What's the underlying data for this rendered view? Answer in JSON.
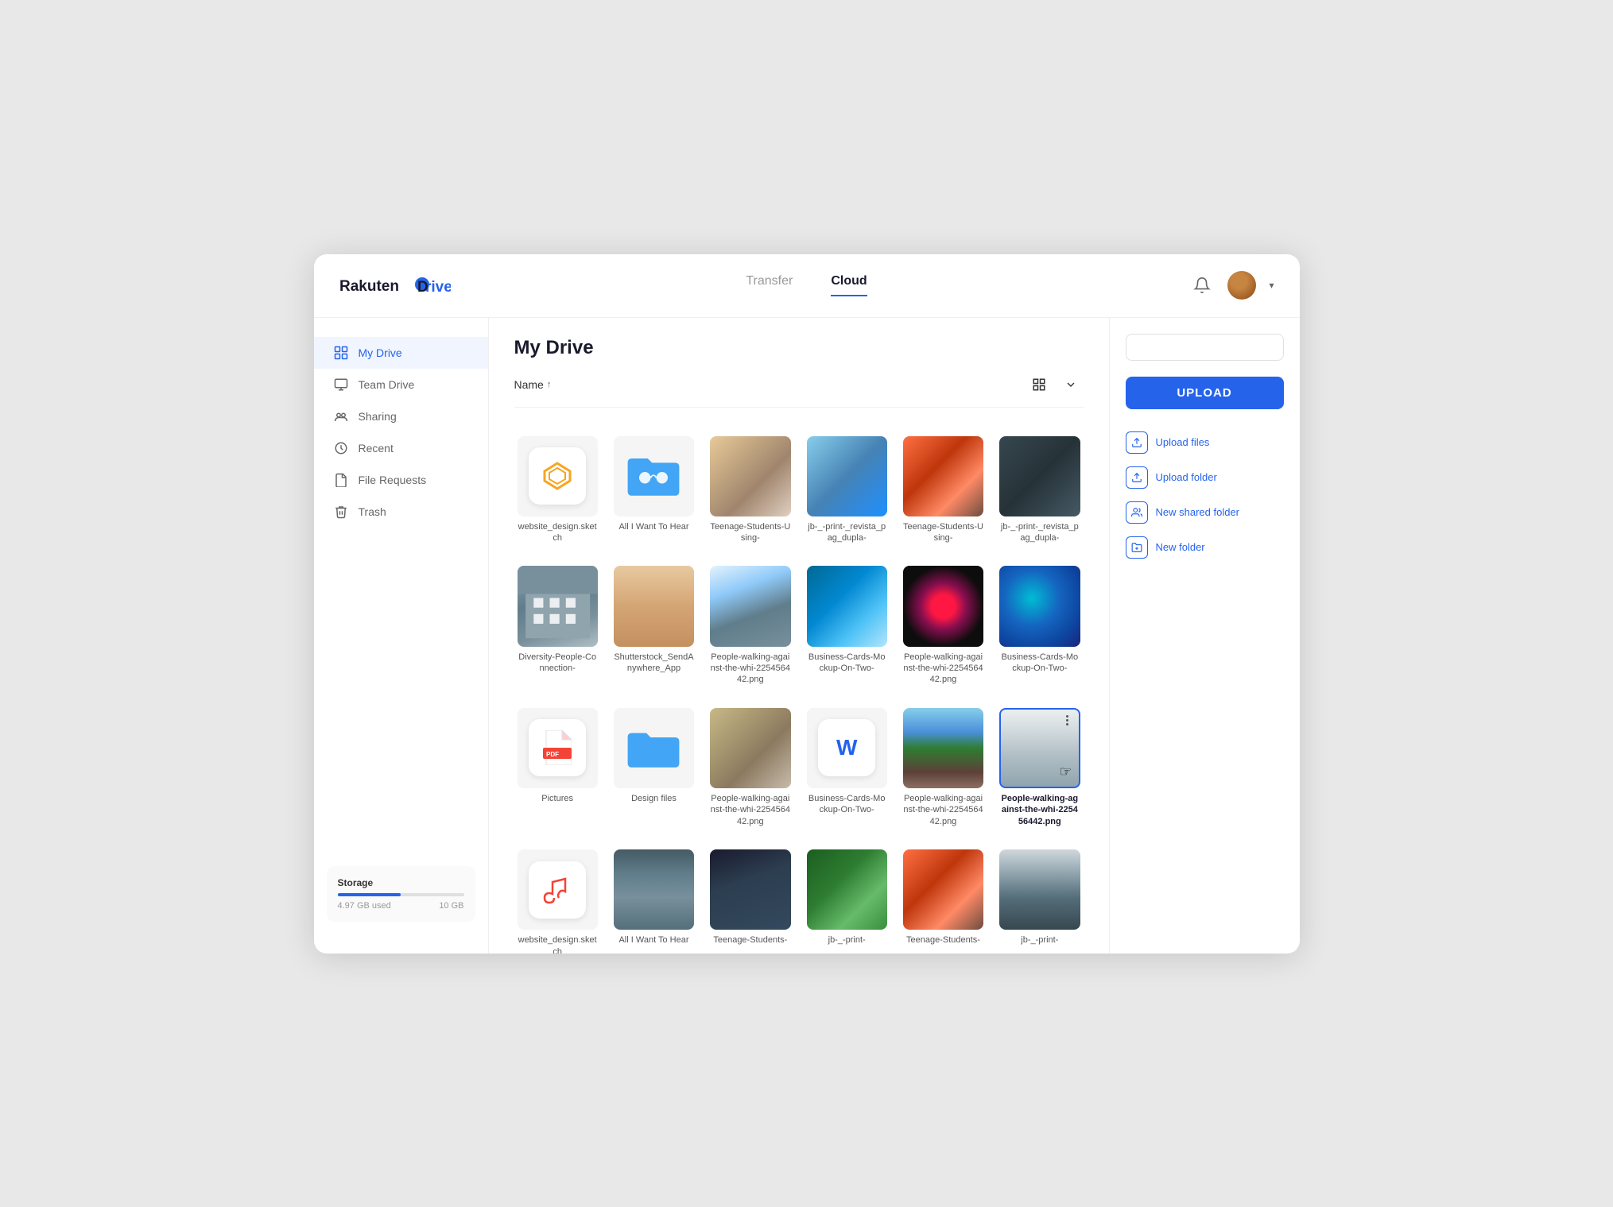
{
  "header": {
    "logo": "Rakuten Drive",
    "tabs": [
      {
        "label": "Transfer",
        "active": false
      },
      {
        "label": "Cloud",
        "active": true
      }
    ]
  },
  "sidebar": {
    "items": [
      {
        "id": "my-drive",
        "label": "My Drive",
        "active": true
      },
      {
        "id": "team-drive",
        "label": "Team Drive",
        "active": false
      },
      {
        "id": "sharing",
        "label": "Sharing",
        "active": false
      },
      {
        "id": "recent",
        "label": "Recent",
        "active": false
      },
      {
        "id": "file-requests",
        "label": "File Requests",
        "active": false
      },
      {
        "id": "trash",
        "label": "Trash",
        "active": false
      }
    ],
    "storage": {
      "label": "Storage",
      "used": "4.97 GB used",
      "total": "10 GB",
      "percent": 49.7
    }
  },
  "content": {
    "title": "My Drive",
    "sort_label": "Name",
    "files": [
      {
        "id": 1,
        "name": "website_design.sketch",
        "type": "sketch",
        "row": 1
      },
      {
        "id": 2,
        "name": "All I Want To Hear",
        "type": "folder-shared",
        "row": 1
      },
      {
        "id": 3,
        "name": "Teenage-Students-Using-",
        "type": "photo-aerial",
        "row": 1
      },
      {
        "id": 4,
        "name": "jb-_-print-_revista_pag_dupla-",
        "type": "photo-blue-water",
        "row": 1
      },
      {
        "id": 5,
        "name": "Teenage-Students-Using-",
        "type": "photo-red-mountain",
        "row": 1
      },
      {
        "id": 6,
        "name": "jb-_-print-_revista_pag_dupla-",
        "type": "photo-dark-rock",
        "row": 1
      },
      {
        "id": 7,
        "name": "Diversity-People-Connection-",
        "type": "photo-building",
        "row": 2
      },
      {
        "id": 8,
        "name": "Shutterstock_SendAnywhere_App",
        "type": "photo-skin",
        "row": 2
      },
      {
        "id": 9,
        "name": "People-walking-against-the-whi-225456442.png",
        "type": "photo-snowy",
        "row": 2
      },
      {
        "id": 10,
        "name": "Business-Cards-Mockup-On-Two-",
        "type": "photo-wave",
        "row": 2
      },
      {
        "id": 11,
        "name": "People-walking-against-the-whi-225456442.png",
        "type": "photo-space",
        "row": 2
      },
      {
        "id": 12,
        "name": "Business-Cards-Mockup-On-Two-",
        "type": "photo-nebula",
        "row": 2
      },
      {
        "id": 13,
        "name": "Pictures",
        "type": "pdf",
        "row": 3
      },
      {
        "id": 14,
        "name": "Design files",
        "type": "folder-blue",
        "row": 3
      },
      {
        "id": 15,
        "name": "People-walking-against-the-whi-225456442.png",
        "type": "photo-aerial2",
        "row": 3
      },
      {
        "id": 16,
        "name": "Business-Cards-Mockup-On-Two-",
        "type": "word",
        "row": 3
      },
      {
        "id": 17,
        "name": "People-walking-against-the-whi-225456442.png",
        "type": "photo-mountain-lake",
        "row": 3
      },
      {
        "id": 18,
        "name": "People-walking-against-the-whi-225456442.png",
        "type": "photo-modern-building",
        "selected": true,
        "row": 3
      },
      {
        "id": 19,
        "name": "website_design.sketch",
        "type": "music",
        "row": 4
      },
      {
        "id": 20,
        "name": "All I Want To Hear",
        "type": "photo-mountain-road",
        "row": 4
      },
      {
        "id": 21,
        "name": "Teenage-Students-",
        "type": "photo-dark2",
        "row": 4
      },
      {
        "id": 22,
        "name": "jb-_-print-",
        "type": "photo-green",
        "row": 4
      },
      {
        "id": 23,
        "name": "Teenage-Students-",
        "type": "photo-redrock",
        "row": 4
      },
      {
        "id": 24,
        "name": "jb-_-print-",
        "type": "photo-foggy",
        "row": 4
      }
    ]
  },
  "right_panel": {
    "search_placeholder": "",
    "upload_label": "UPLOAD",
    "actions": [
      {
        "id": "upload-files",
        "label": "Upload files"
      },
      {
        "id": "upload-folder",
        "label": "Upload folder"
      },
      {
        "id": "new-shared-folder",
        "label": "New shared folder"
      },
      {
        "id": "new-folder",
        "label": "New folder"
      }
    ]
  }
}
